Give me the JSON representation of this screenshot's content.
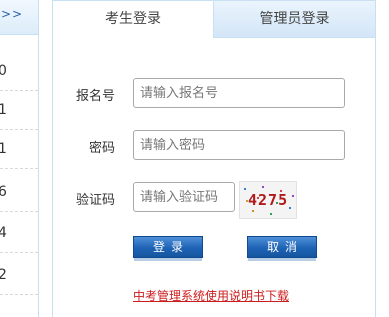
{
  "left_panel": {
    "header": ">>",
    "rows": [
      "0",
      "1",
      "1",
      "6",
      "4",
      "2"
    ]
  },
  "tabs": [
    {
      "label": "考生登录",
      "active": true
    },
    {
      "label": "管理员登录",
      "active": false
    }
  ],
  "form": {
    "registration": {
      "label": "报名号",
      "placeholder": "请输入报名号",
      "value": ""
    },
    "password": {
      "label": "密码",
      "placeholder": "请输入密码",
      "value": ""
    },
    "captcha": {
      "label": "验证码",
      "placeholder": "请输入验证码",
      "value": "",
      "image_text": "4275"
    }
  },
  "buttons": {
    "login": "登录",
    "cancel": "取消"
  },
  "download_link": "中考管理系统使用说明书下载",
  "colors": {
    "accent_blue": "#1f63b5",
    "border_blue": "#c9dff2",
    "link_red": "#cc1d1d",
    "captcha_red": "#b01a1a"
  }
}
